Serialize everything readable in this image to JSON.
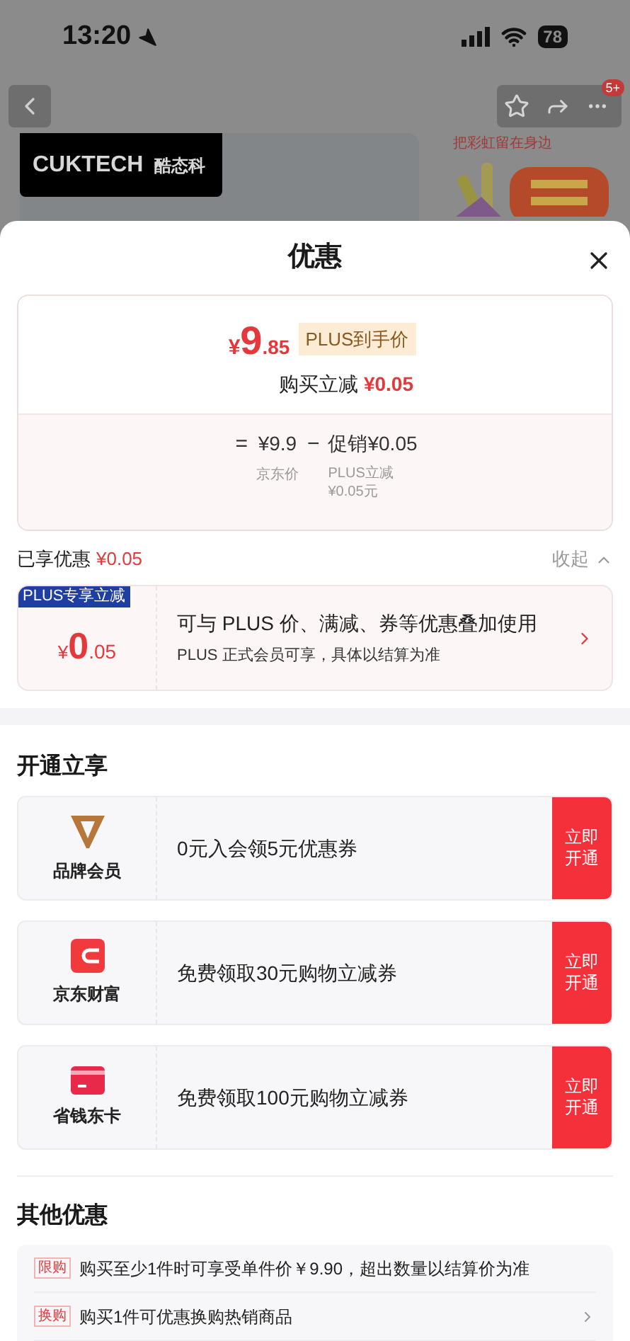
{
  "status_bar": {
    "time": "13:20",
    "battery": "78"
  },
  "background": {
    "brand_latin": "CUKTECH",
    "brand_cn": "酷态科",
    "banner_text": "把彩虹留在身边",
    "badge": "5+"
  },
  "sheet": {
    "title": "优惠"
  },
  "price_card": {
    "currency": "¥",
    "integer": "9",
    "decimal": ".85",
    "tag": "PLUS到手价",
    "reduction_label": "购买立减",
    "reduction_value": "¥0.05",
    "formula": {
      "equals": "=",
      "base": "¥9.9",
      "base_label": "京东价",
      "minus": "−",
      "promo": "促销¥0.05",
      "promo_label": [
        "PLUS立减",
        "¥0.05元"
      ]
    }
  },
  "enjoyed": {
    "label": "已享优惠",
    "value": "¥0.05",
    "collapse": "收起"
  },
  "plus_card": {
    "ribbon": "PLUS专享立减",
    "currency": "¥",
    "integer": "0",
    "decimal": ".05",
    "title": "可与 PLUS 价、满减、券等优惠叠加使用",
    "subtitle": "PLUS 正式会员可享，具体以结算为准"
  },
  "open_section": {
    "title": "开通立享",
    "items": [
      {
        "kind": "brand",
        "name": "品牌会员",
        "offer": "0元入会领5元优惠券",
        "button": [
          "立即",
          "开通"
        ]
      },
      {
        "kind": "wallet",
        "name": "京东财富",
        "offer": "免费领取30元购物立减券",
        "button": [
          "立即",
          "开通"
        ]
      },
      {
        "kind": "card",
        "name": "省钱东卡",
        "offer": "免费领取100元购物立减券",
        "button": [
          "立即",
          "开通"
        ]
      }
    ]
  },
  "other_section": {
    "title": "其他优惠",
    "items": [
      {
        "tag": "限购",
        "text": "购买至少1件时可享受单件价￥9.90，超出数量以结算价为准",
        "chevron": false
      },
      {
        "tag": "换购",
        "text": "购买1件可优惠换购热销商品",
        "chevron": true
      }
    ]
  }
}
